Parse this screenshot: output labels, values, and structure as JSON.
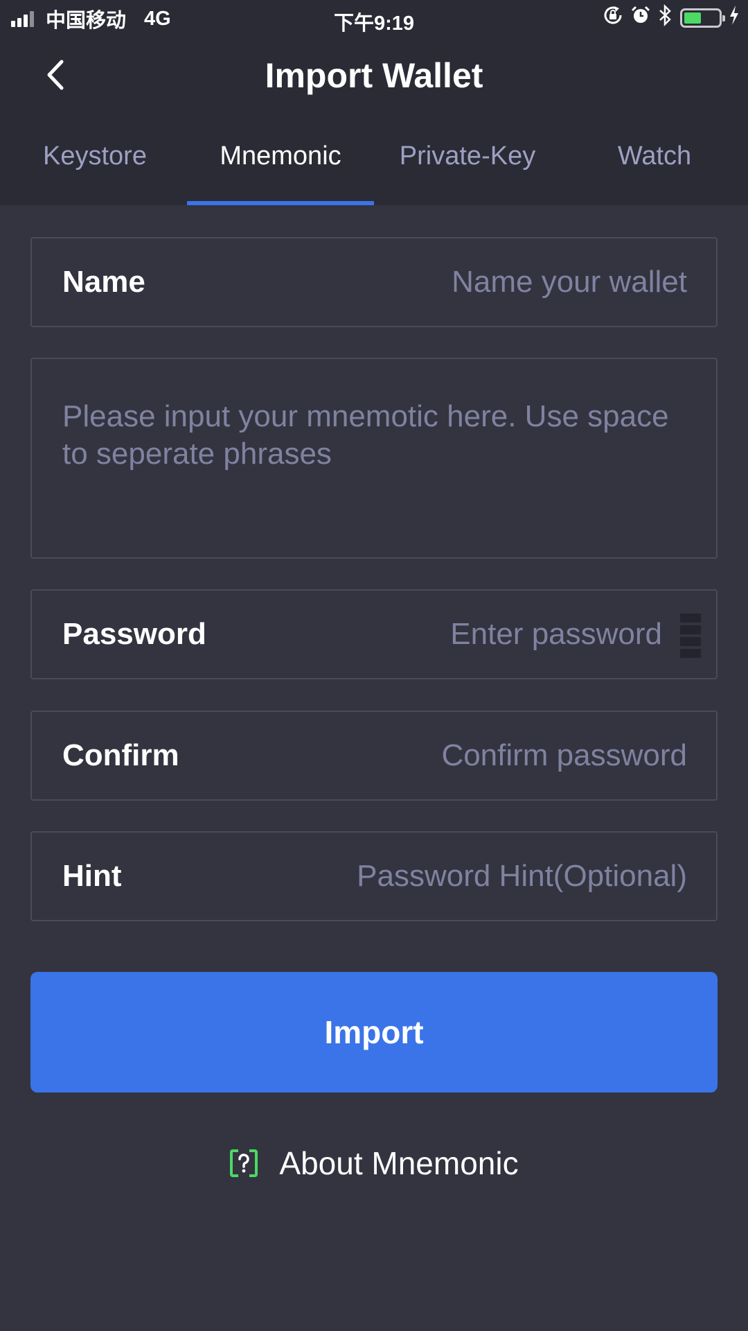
{
  "status_bar": {
    "carrier": "中国移动",
    "network": "4G",
    "time": "下午9:19",
    "battery_level": 0.5,
    "battery_color": "#4cd964"
  },
  "nav": {
    "back_icon": "chevron-left-icon",
    "title": "Import Wallet"
  },
  "tabs": [
    {
      "label": "Keystore",
      "active": false
    },
    {
      "label": "Mnemonic",
      "active": true
    },
    {
      "label": "Private-Key",
      "active": false
    },
    {
      "label": "Watch",
      "active": false
    }
  ],
  "form": {
    "name": {
      "label": "Name",
      "placeholder": "Name your wallet"
    },
    "mnemonic": {
      "placeholder": "Please input your mnemotic here. Use space to seperate phrases"
    },
    "password": {
      "label": "Password",
      "placeholder": "Enter password",
      "strength_bars": 4
    },
    "confirm": {
      "label": "Confirm",
      "placeholder": "Confirm password"
    },
    "hint": {
      "label": "Hint",
      "placeholder": "Password Hint(Optional)"
    }
  },
  "import_button": {
    "label": "Import"
  },
  "about": {
    "icon": "question-icon",
    "label": "About Mnemonic"
  },
  "colors": {
    "accent": "#3a74e8",
    "background": "#333440",
    "header": "#2a2b35",
    "help_icon": "#4cd964"
  }
}
